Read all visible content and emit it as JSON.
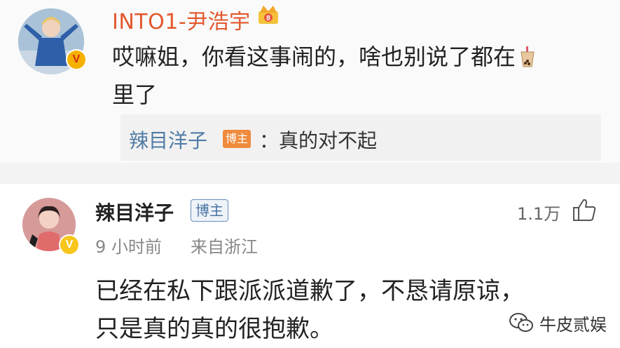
{
  "top_comment": {
    "username": "INTO1-尹浩宇",
    "text": "哎嘛姐，你看这事闹的，啥也别说了都在",
    "text_cont": "里了",
    "reply": {
      "username": "辣目洋子",
      "tag": "博主",
      "separator": "：",
      "text": "真的对不起"
    }
  },
  "second_comment": {
    "username": "辣目洋子",
    "tag": "博主",
    "time": "9 小时前",
    "location": "来自浙江",
    "likes": "1.1万",
    "text_line1": "已经在私下跟派派道歉了，不恳请原谅，",
    "text_line2": "只是真的真的很抱歉。"
  },
  "watermark": {
    "text": "牛皮贰娱"
  },
  "badges": {
    "v_top": "V",
    "v_second": "V"
  },
  "colors": {
    "username_orange": "#e2572c",
    "reply_blue": "#4f7ca6",
    "verified_gold": "#f5b000"
  },
  "icons": [
    "crown-icon",
    "bubble-tea-icon",
    "thumb-up-icon",
    "wechat-icon"
  ]
}
